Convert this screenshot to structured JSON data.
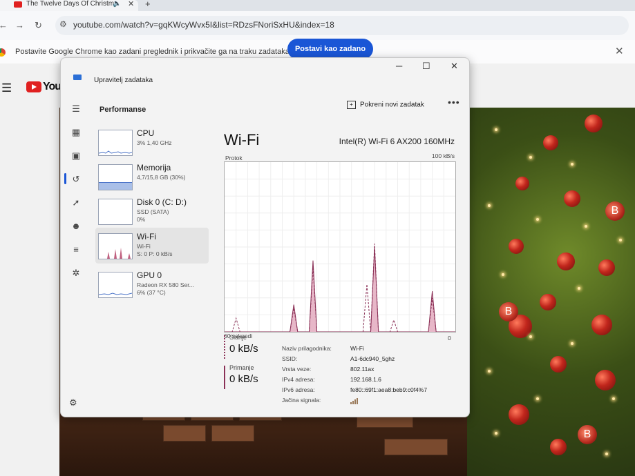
{
  "browser": {
    "tab_title": "The Twelve Days Of Christm",
    "tab_mute_icon": "speaker-icon",
    "tab_close": "✕",
    "new_tab": "+",
    "url": "youtube.com/watch?v=gqKWcyWvx5I&list=RDzsFNoriSxHU&index=18",
    "infobar_message": "Postavite Google Chrome kao zadani preglednik i prikvačite ga na traku zadataka",
    "infobar_button": "Postavi kao zadano",
    "infobar_close": "✕"
  },
  "youtube": {
    "logo_text": "YouT"
  },
  "taskmanager": {
    "title": "Upravitelj zadataka",
    "page_title": "Performanse",
    "run_new_task": "Pokreni novi zadatak",
    "more": "•••",
    "devices": [
      {
        "name": "CPU",
        "sub1": "3% 1,40 GHz",
        "sub2": "",
        "sub3": ""
      },
      {
        "name": "Memorija",
        "sub1": "4,7/15,8 GB (30%)",
        "sub2": "",
        "sub3": ""
      },
      {
        "name": "Disk 0 (C: D:)",
        "sub1": "SSD (SATA)",
        "sub2": "0%",
        "sub3": ""
      },
      {
        "name": "Wi-Fi",
        "sub1": "Wi-Fi",
        "sub2": "S: 0 P: 0 kB/s",
        "sub3": ""
      },
      {
        "name": "GPU 0",
        "sub1": "Radeon RX 580 Ser...",
        "sub2": "6% (37 °C)",
        "sub3": ""
      }
    ],
    "selected_device": "Wi-Fi",
    "detail": {
      "heading": "Wi-Fi",
      "adapter_model": "Intel(R) Wi-Fi 6 AX200 160MHz",
      "graph_label": "Protok",
      "graph_max": "100 kB/s",
      "graph_time": "60 sekundi",
      "graph_min": "0"
    },
    "send": {
      "label": "Slanje",
      "value": "0 kB/s"
    },
    "receive": {
      "label": "Primanje",
      "value": "0 kB/s"
    },
    "properties": [
      {
        "key": "Naziv prilagodnika:",
        "value": "Wi-Fi"
      },
      {
        "key": "SSID:",
        "value": "A1-6dc940_5ghz"
      },
      {
        "key": "Vrsta veze:",
        "value": "802.11ax"
      },
      {
        "key": "IPv4 adresa:",
        "value": "192.168.1.6"
      },
      {
        "key": "IPv6 adresa:",
        "value": "fe80::69f1:aea8:beb9:c0f4%7"
      },
      {
        "key": "Jačina signala:",
        "value": ""
      }
    ],
    "accent_color": "#8a3056",
    "graph_fill": "#e7b7c8"
  },
  "chart_data": {
    "type": "area",
    "title": "",
    "xlabel": "60 sekundi",
    "ylabel": "Protok",
    "ylim": [
      0,
      100
    ],
    "x": [
      0,
      1,
      2,
      3,
      4,
      5,
      6,
      7,
      8,
      9,
      10,
      11,
      12,
      13,
      14,
      15,
      16,
      17,
      18,
      19,
      20,
      21,
      22,
      23,
      24,
      25,
      26,
      27,
      28,
      29,
      30,
      31,
      32,
      33,
      34,
      35,
      36,
      37,
      38,
      39,
      40,
      41,
      42,
      43,
      44,
      45,
      46,
      47,
      48,
      49,
      50,
      51,
      52,
      53,
      54,
      55,
      56,
      57,
      58,
      59,
      60
    ],
    "series": [
      {
        "name": "Primanje",
        "style": "solid",
        "values": [
          0,
          0,
          0,
          0,
          0,
          0,
          0,
          0,
          0,
          0,
          0,
          0,
          0,
          0,
          0,
          0,
          0,
          0,
          16,
          0,
          0,
          0,
          0,
          42,
          0,
          0,
          0,
          0,
          0,
          0,
          0,
          0,
          0,
          0,
          0,
          0,
          0,
          0,
          0,
          50,
          0,
          0,
          0,
          0,
          0,
          0,
          0,
          0,
          0,
          0,
          0,
          0,
          0,
          0,
          24,
          0,
          0,
          0,
          0,
          0,
          0
        ]
      },
      {
        "name": "Slanje",
        "style": "dashed",
        "values": [
          0,
          0,
          0,
          8,
          0,
          0,
          0,
          0,
          0,
          0,
          0,
          0,
          0,
          0,
          0,
          0,
          0,
          0,
          14,
          0,
          0,
          0,
          0,
          38,
          0,
          0,
          0,
          0,
          0,
          0,
          0,
          0,
          0,
          0,
          0,
          0,
          0,
          28,
          0,
          52,
          0,
          0,
          0,
          0,
          7,
          0,
          0,
          0,
          0,
          0,
          0,
          0,
          0,
          0,
          20,
          0,
          0,
          0,
          0,
          0,
          0
        ]
      }
    ]
  }
}
